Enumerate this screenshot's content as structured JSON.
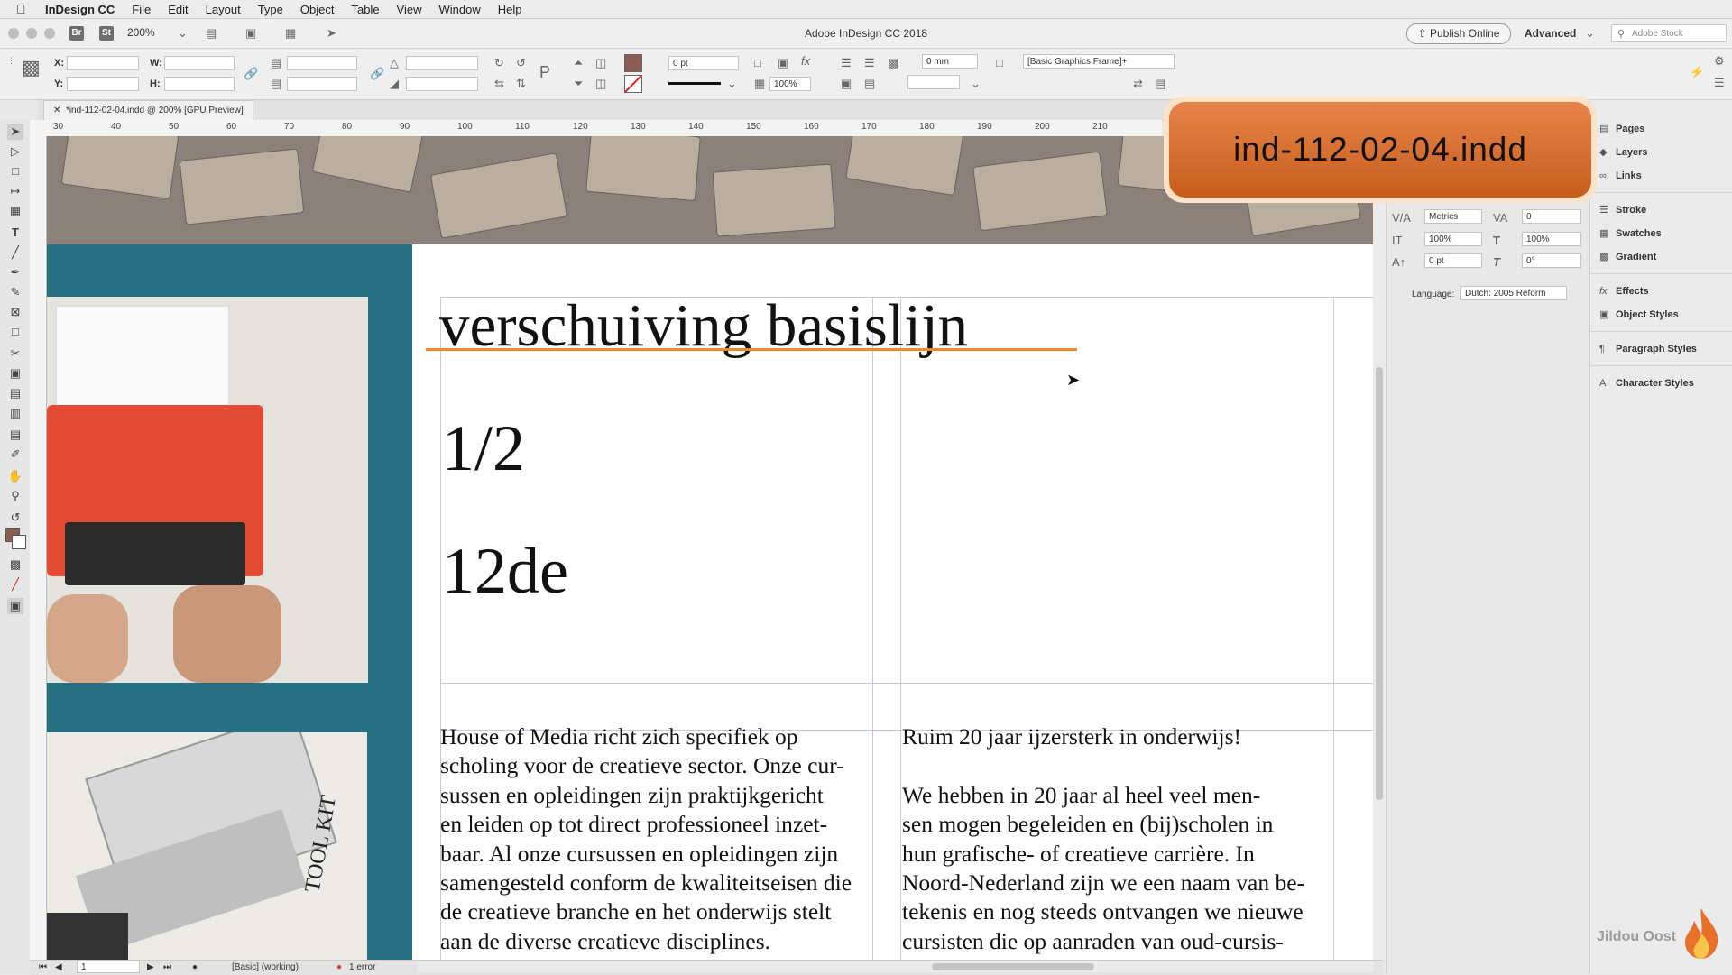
{
  "menubar": {
    "app_name": "InDesign CC",
    "items": [
      "File",
      "Edit",
      "Layout",
      "Type",
      "Object",
      "Table",
      "View",
      "Window",
      "Help"
    ]
  },
  "appbar": {
    "bridge": "Br",
    "stock": "St",
    "zoom": "200%",
    "title": "Adobe InDesign CC 2018",
    "publish_label": "Publish Online",
    "workspace": "Advanced",
    "search_placeholder": "Adobe Stock"
  },
  "control": {
    "x_label": "X:",
    "y_label": "Y:",
    "w_label": "W:",
    "h_label": "H:",
    "stroke_weight": "0 pt",
    "scale": "100%",
    "offset": "0 mm",
    "object_style": "[Basic Graphics Frame]+"
  },
  "document": {
    "tab_label": "*ind-112-02-04.indd @ 200% [GPU Preview]",
    "ruler_ticks": [
      "30",
      "40",
      "50",
      "60",
      "70",
      "80",
      "90",
      "100",
      "110",
      "120",
      "130",
      "140",
      "150",
      "160",
      "170",
      "180",
      "190",
      "200",
      "210"
    ],
    "headline": "verschuiving basislijn",
    "big1": "1/2",
    "big2": "12de",
    "col1_text": "House of Media richt zich specifiek op\nscholing voor de creatieve sector. Onze cur-\nsussen en opleidingen zijn praktijkgericht\nen leiden op tot direct professioneel inzet-\nbaar. Al onze cursussen en opleidingen zijn\nsamengesteld conform de kwaliteitseisen die\nde creatieve branche en het onderwijs stelt\naan de diverse creatieve disciplines.",
    "col2_text": "Ruim 20 jaar ijzersterk in onderwijs!\n\nWe hebben in 20 jaar al heel veel men-\nsen mogen begeleiden en (bij)scholen in\nhun grafische- of creatieve carrière. In\nNoord-Nederland zijn we een naam van be-\ntekenis en nog steeds ontvangen we nieuwe\ncursisten die op aanraden van oud-cursis-",
    "photo2_text": "TOOL KIT"
  },
  "status": {
    "page": "1",
    "preflight_profile": "[Basic] (working)",
    "errors": "1 error"
  },
  "character_panel": {
    "kerning": "Metrics",
    "tracking": "0",
    "vertical_scale": "100%",
    "horizontal_scale": "100%",
    "baseline_shift": "0 pt",
    "skew": "0°",
    "language_label": "Language:",
    "language": "Dutch: 2005 Reform"
  },
  "dock": {
    "items": [
      "Pages",
      "Layers",
      "Links",
      "Stroke",
      "Swatches",
      "Gradient",
      "Effects",
      "Object Styles",
      "Paragraph Styles",
      "Character Styles"
    ]
  },
  "overlay": {
    "filename": "ind-112-02-04.indd",
    "watermark": "Jildou Oost"
  },
  "colors": {
    "teal": "#267082",
    "accent_orange": "#ee8a29",
    "badge": "#d96d2c"
  }
}
